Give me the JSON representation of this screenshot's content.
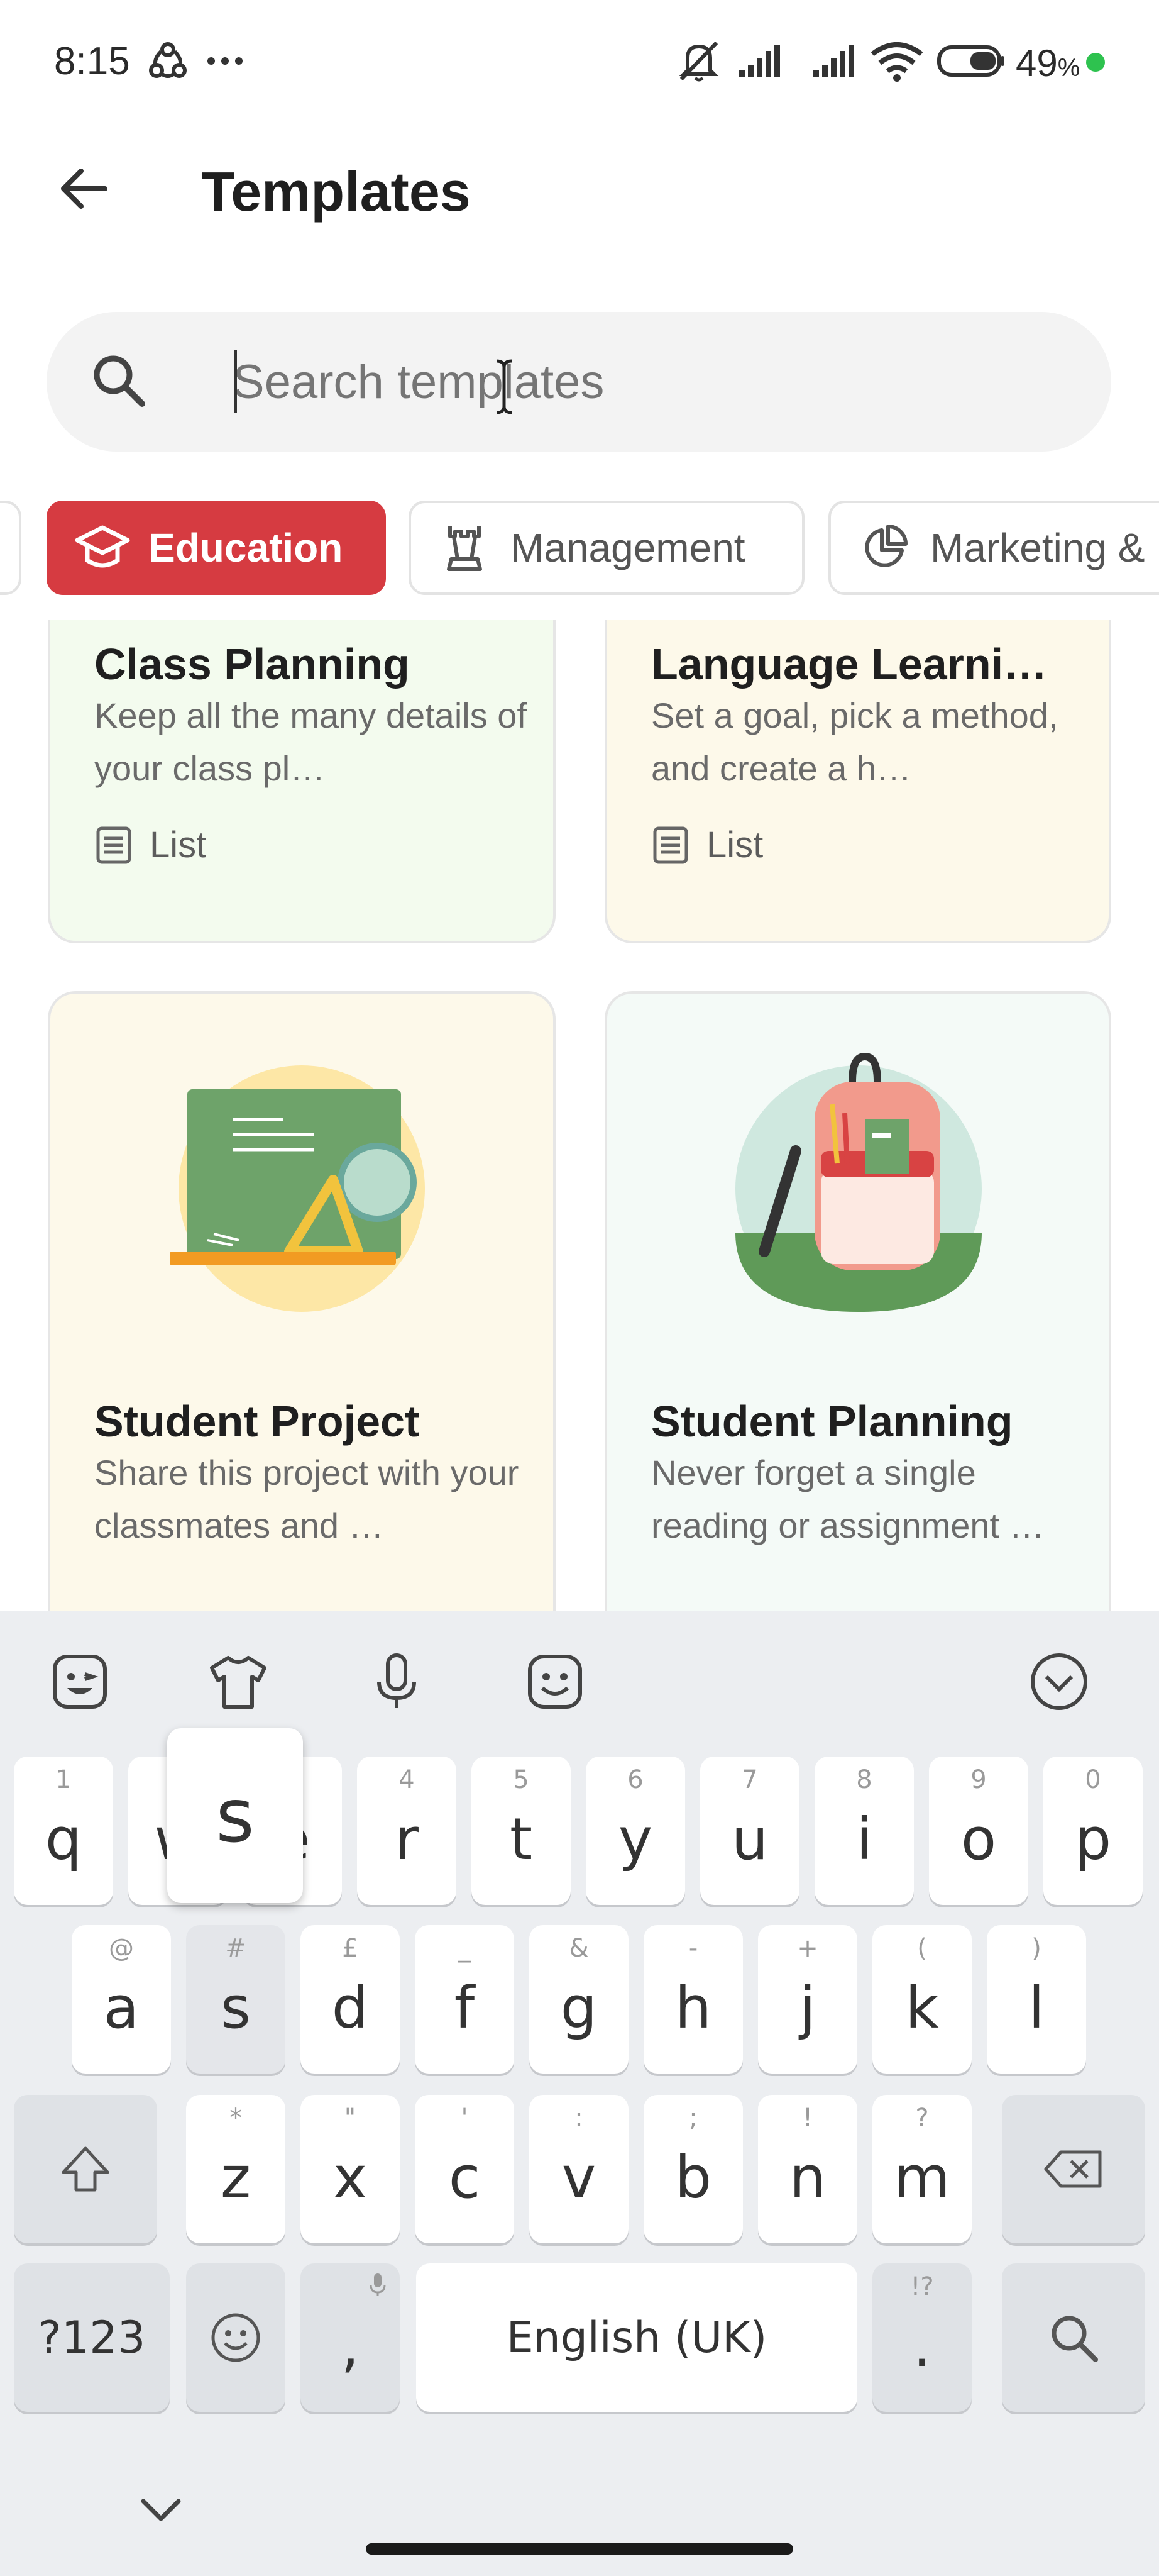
{
  "status_bar": {
    "time": "8:15",
    "battery": "49",
    "battery_unit": "%"
  },
  "header": {
    "title": "Templates",
    "back_icon": "arrow-left-icon"
  },
  "search": {
    "placeholder": "Search templates",
    "value": ""
  },
  "chips": [
    {
      "label": "Education",
      "icon": "graduation-cap-icon",
      "active": true
    },
    {
      "label": "Management",
      "icon": "chess-rook-icon",
      "active": false
    },
    {
      "label": "Marketing &",
      "icon": "pie-chart-icon",
      "active": false
    }
  ],
  "cards": [
    {
      "title": "Class Planning",
      "desc": "Keep all the many details of your class pl…",
      "type": "List",
      "bg": "#f3fbee"
    },
    {
      "title": "Language Learni…",
      "desc": "Set a goal, pick a method, and create a h…",
      "type": "List",
      "bg": "#fdf9ea"
    },
    {
      "title": "Student Project",
      "desc": "Share this project with your classmates and …",
      "bg": "#fdf9ea"
    },
    {
      "title": "Student Planning",
      "desc": "Never forget a single reading or assignment …",
      "bg": "#f4faf7"
    }
  ],
  "keyboard": {
    "row1": [
      {
        "key": "q",
        "hint": "1"
      },
      {
        "key": "w",
        "hint": "2"
      },
      {
        "key": "e",
        "hint": "3"
      },
      {
        "key": "r",
        "hint": "4"
      },
      {
        "key": "t",
        "hint": "5"
      },
      {
        "key": "y",
        "hint": "6"
      },
      {
        "key": "u",
        "hint": "7"
      },
      {
        "key": "i",
        "hint": "8"
      },
      {
        "key": "o",
        "hint": "9"
      },
      {
        "key": "p",
        "hint": "0"
      }
    ],
    "row2": [
      {
        "key": "a",
        "hint": "@"
      },
      {
        "key": "s",
        "hint": "#"
      },
      {
        "key": "d",
        "hint": "£"
      },
      {
        "key": "f",
        "hint": "_"
      },
      {
        "key": "g",
        "hint": "&"
      },
      {
        "key": "h",
        "hint": "-"
      },
      {
        "key": "j",
        "hint": "+"
      },
      {
        "key": "k",
        "hint": "("
      },
      {
        "key": "l",
        "hint": ")"
      }
    ],
    "row3": [
      {
        "key": "z",
        "hint": "*"
      },
      {
        "key": "x",
        "hint": "\""
      },
      {
        "key": "c",
        "hint": "'"
      },
      {
        "key": "v",
        "hint": ":"
      },
      {
        "key": "b",
        "hint": ";"
      },
      {
        "key": "n",
        "hint": "!"
      },
      {
        "key": "m",
        "hint": "?"
      }
    ],
    "symbols_label": "?123",
    "comma": ",",
    "space_label": "English (UK)",
    "period": ".",
    "period_hint": "!?",
    "popup_letter": "s",
    "pressed_key": "s"
  }
}
